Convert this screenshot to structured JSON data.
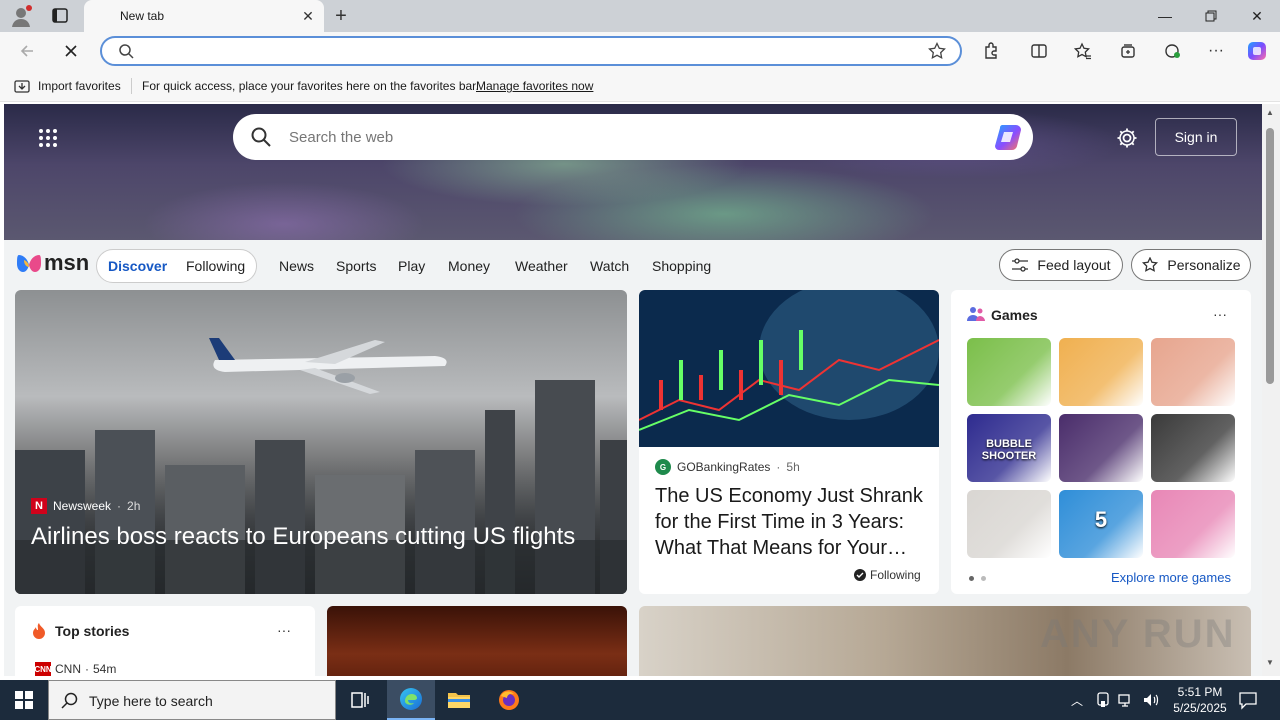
{
  "browser": {
    "tab_title": "New tab",
    "address_value": "",
    "favbar_import": "Import favorites",
    "favbar_hint": "For quick access, place your favorites here on the favorites bar.",
    "favbar_manage": "Manage favorites now"
  },
  "msn": {
    "search_placeholder": "Search the web",
    "signin": "Sign in",
    "logo": "msn",
    "tabs": [
      "Discover",
      "Following"
    ],
    "nav": [
      "News",
      "Sports",
      "Play",
      "Money",
      "Weather",
      "Watch",
      "Shopping"
    ],
    "feed_layout": "Feed layout",
    "personalize": "Personalize"
  },
  "hero_story": {
    "source": "Newsweek",
    "age": "2h",
    "headline": "Airlines boss reacts to Europeans cutting US flights"
  },
  "story2": {
    "source": "GOBankingRates",
    "age": "5h",
    "headline": "The US Economy Just Shrank for the First Time in 3 Years: What That Means for Your…",
    "following": "Following"
  },
  "games": {
    "title": "Games",
    "more": "Explore more games",
    "tiles": [
      {
        "color": "#7bbf4a"
      },
      {
        "color": "#f0b050"
      },
      {
        "color": "#e7a58e"
      },
      {
        "color": "#2e2b8f",
        "label": "BUBBLE SHOOTER"
      },
      {
        "color": "#4a2d6b"
      },
      {
        "color": "#3a3a3a"
      },
      {
        "color": "#d9d6d2"
      },
      {
        "color": "#2f8ed8",
        "label": "5"
      },
      {
        "color": "#e887b6"
      }
    ]
  },
  "top_stories": {
    "title": "Top stories",
    "source": "CNN",
    "age": "54m"
  },
  "watermark": "ANY RUN",
  "taskbar": {
    "search_placeholder": "Type here to search",
    "time": "5:51 PM",
    "date": "5/25/2025"
  }
}
